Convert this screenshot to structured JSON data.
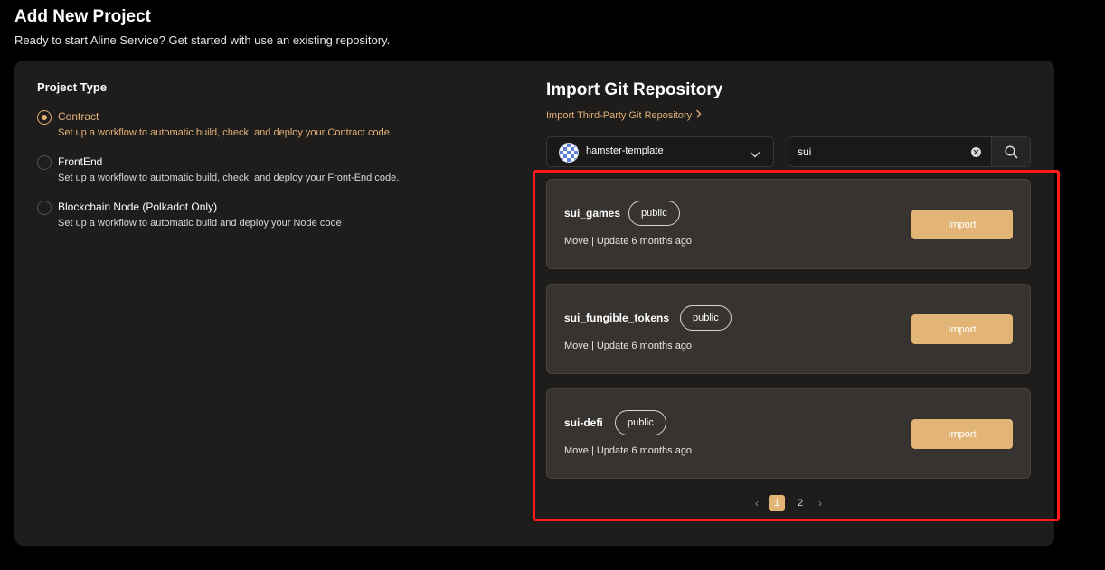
{
  "header": {
    "title": "Add New Project",
    "subtitle": "Ready to start Aline Service? Get started with use an existing repository."
  },
  "project_type": {
    "label": "Project Type",
    "options": [
      {
        "title": "Contract",
        "description": "Set up a workflow to automatic build, check, and deploy your Contract code.",
        "selected": true
      },
      {
        "title": "FrontEnd",
        "description": "Set up a workflow to automatic build, check, and deploy your Front-End code.",
        "selected": false
      },
      {
        "title": "Blockchain Node (Polkadot Only)",
        "description": "Set up a workflow to automatic build and deploy your Node code",
        "selected": false
      }
    ]
  },
  "import": {
    "title": "Import Git Repository",
    "third_party_link": "Import Third-Party Git Repository",
    "account_select": {
      "value": "hamster-template",
      "icon": "chevron-down-icon"
    },
    "search": {
      "value": "sui",
      "icon": "search-icon",
      "clear_icon": "clear-icon"
    },
    "repos": [
      {
        "name": "sui_games",
        "visibility": "public",
        "meta": "Move | Update 6 months ago",
        "button": "Import"
      },
      {
        "name": "sui_fungible_tokens",
        "visibility": "public",
        "meta": "Move | Update 6 months ago",
        "button": "Import"
      },
      {
        "name": "sui-defi",
        "visibility": "public",
        "meta": "Move | Update 6 months ago",
        "button": "Import"
      }
    ],
    "pagination": {
      "prev": "‹",
      "next": "›",
      "pages": [
        "1",
        "2"
      ],
      "current": "1"
    }
  },
  "colors": {
    "accent": "#e2b577",
    "background": "#000000",
    "card": "#1e1d1c",
    "repo_card": "#363330",
    "highlight": "#ff1a1a"
  }
}
